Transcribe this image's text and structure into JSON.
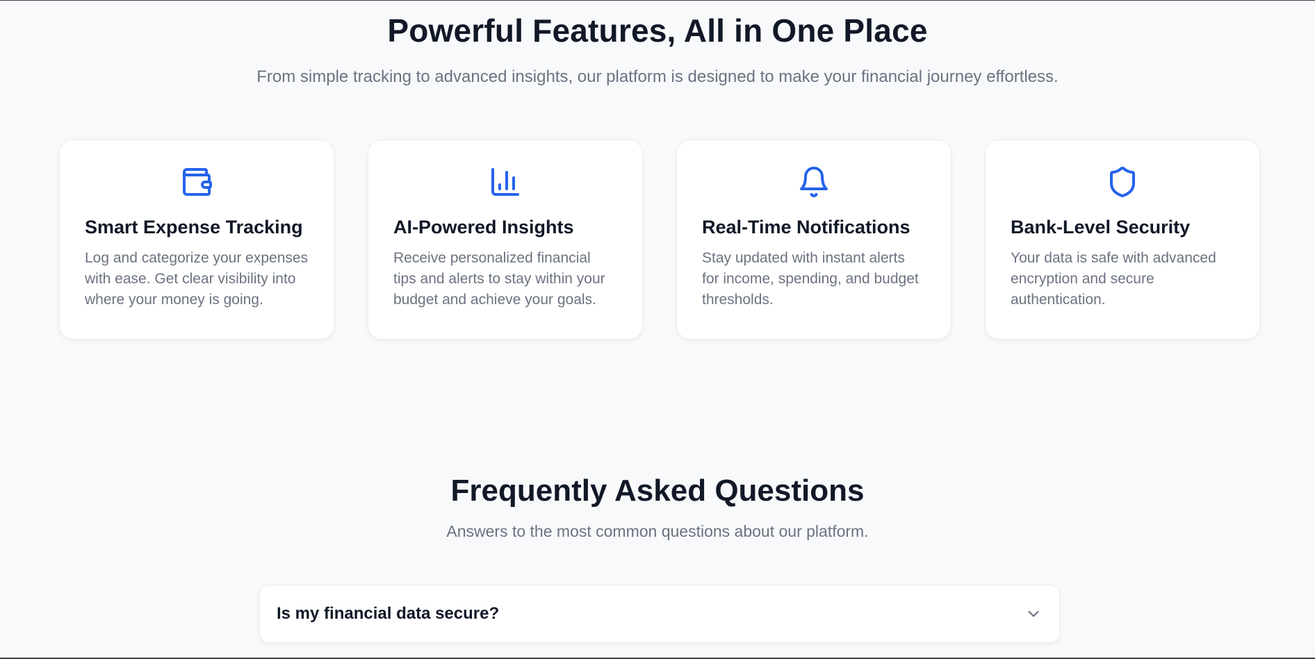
{
  "features": {
    "title": "Powerful Features, All in One Place",
    "subtitle": "From simple tracking to advanced insights, our platform is designed to make your financial journey effortless.",
    "cards": [
      {
        "icon": "wallet-icon",
        "title": "Smart Expense Tracking",
        "description": "Log and categorize your expenses with ease. Get clear visibility into where your money is going."
      },
      {
        "icon": "bar-chart-icon",
        "title": "AI-Powered Insights",
        "description": "Receive personalized financial tips and alerts to stay within your budget and achieve your goals."
      },
      {
        "icon": "bell-icon",
        "title": "Real-Time Notifications",
        "description": "Stay updated with instant alerts for income, spending, and budget thresholds."
      },
      {
        "icon": "shield-icon",
        "title": "Bank-Level Security",
        "description": "Your data is safe with advanced encryption and secure authentication."
      }
    ]
  },
  "faq": {
    "title": "Frequently Asked Questions",
    "subtitle": "Answers to the most common questions about our platform.",
    "items": [
      {
        "question": "Is my financial data secure?",
        "icon": "chevron-down-icon",
        "expanded": false
      }
    ]
  },
  "colors": {
    "accent": "#2563eb",
    "background": "#f8f9fb",
    "heading": "#111827",
    "muted": "#6b7280",
    "card": "#ffffff"
  }
}
